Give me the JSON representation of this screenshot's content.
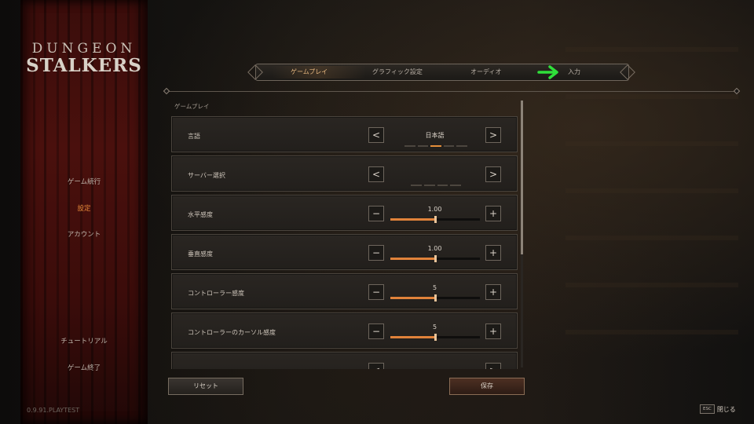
{
  "logo": {
    "line1": "DUNGEON",
    "line2": "STALKERS"
  },
  "sidebar": {
    "items": [
      {
        "label": "ゲーム続行",
        "active": false
      },
      {
        "label": "設定",
        "active": true
      },
      {
        "label": "アカウント",
        "active": false
      }
    ],
    "bottom_items": [
      {
        "label": "チュートリアル"
      },
      {
        "label": "ゲーム終了"
      }
    ],
    "version": "0.9.91.PLAYTEST"
  },
  "tabs": [
    {
      "label": "ゲームプレイ",
      "active": true
    },
    {
      "label": "グラフィック設定",
      "active": false
    },
    {
      "label": "オーディオ",
      "active": false
    },
    {
      "label": "入力",
      "active": false
    }
  ],
  "section_title": "ゲームプレイ",
  "settings": [
    {
      "label": "言語",
      "type": "selector",
      "value": "日本語",
      "pages": 5,
      "current_page": 3
    },
    {
      "label": "サーバー選択",
      "type": "selector",
      "value": "",
      "pages": 4,
      "current_page": 0
    },
    {
      "label": "水平感度",
      "type": "slider",
      "value": "1.00",
      "fraction": 0.5
    },
    {
      "label": "垂直感度",
      "type": "slider",
      "value": "1.00",
      "fraction": 0.5
    },
    {
      "label": "コントローラー感度",
      "type": "slider",
      "value": "5",
      "fraction": 0.5
    },
    {
      "label": "コントローラーのカーソル感度",
      "type": "slider",
      "value": "5",
      "fraction": 0.5
    }
  ],
  "buttons": {
    "prev": "<",
    "next": ">",
    "minus": "−",
    "plus": "+",
    "reset": "リセット",
    "save": "保存",
    "esc_key": "ESC",
    "close": "閉じる"
  },
  "colors": {
    "accent": "#e58f3a",
    "active_tab": "#e6b77f",
    "arrow": "#2fe03a"
  }
}
